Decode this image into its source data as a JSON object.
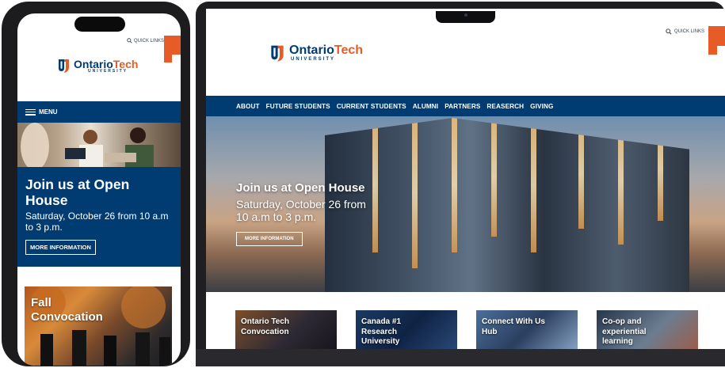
{
  "brand": {
    "name_part1": "Ontario",
    "name_part2": "Tech",
    "sub": "UNIVERSITY",
    "colors": {
      "navy": "#003c71",
      "orange": "#e75b26"
    }
  },
  "header": {
    "quick_links": "QUICK LINKS",
    "search_icon": "search-icon"
  },
  "mobile": {
    "menu_label": "MENU",
    "hero": {
      "title": "Join us at Open House",
      "subtitle": "Saturday, October 26 from 10 a.m to 3 p.m.",
      "button": "MORE INFORMATION"
    },
    "feature": {
      "label": "Fall Convocation"
    }
  },
  "desktop": {
    "nav": [
      "ABOUT",
      "FUTURE STUDENTS",
      "CURRENT STUDENTS",
      "ALUMNI",
      "PARTNERS",
      "REASERCH",
      "GIVING"
    ],
    "hero": {
      "title": "Join us at Open House",
      "subtitle": "Saturday, October 26 from 10 a.m to 3 p.m.",
      "button": "MORE INFORMATION"
    },
    "cards": [
      {
        "label": "Ontario Tech Convocation"
      },
      {
        "label": "Canada #1 Research University"
      },
      {
        "label": "Connect With Us Hub"
      },
      {
        "label": "Co-op and experiential learning"
      }
    ]
  }
}
